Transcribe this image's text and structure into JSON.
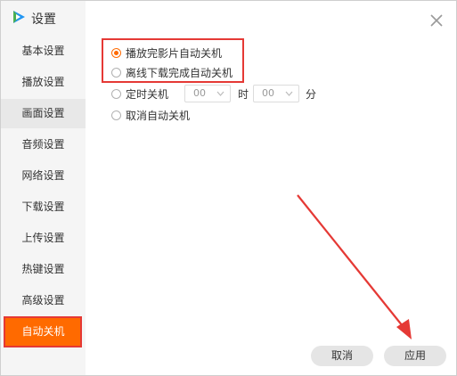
{
  "window": {
    "title": "设置",
    "close_icon": "close-icon",
    "logo_icon": "play-logo-icon"
  },
  "sidebar": {
    "items": [
      {
        "label": "基本设置"
      },
      {
        "label": "播放设置"
      },
      {
        "label": "画面设置"
      },
      {
        "label": "音频设置"
      },
      {
        "label": "网络设置"
      },
      {
        "label": "下载设置"
      },
      {
        "label": "上传设置"
      },
      {
        "label": "热键设置"
      },
      {
        "label": "高级设置"
      },
      {
        "label": "自动关机"
      }
    ],
    "active_index": 9,
    "hover_index": 2
  },
  "options": {
    "after_play": {
      "label": "播放完影片自动关机",
      "checked": true
    },
    "after_download": {
      "label": "离线下载完成自动关机",
      "checked": false
    },
    "timed": {
      "label": "定时关机",
      "checked": false,
      "hour_value": "00",
      "hour_unit": "时",
      "minute_value": "00",
      "minute_unit": "分"
    },
    "cancel": {
      "label": "取消自动关机",
      "checked": false
    }
  },
  "buttons": {
    "cancel_label": "取消",
    "apply_label": "应用"
  },
  "colors": {
    "accent": "#ff6a00",
    "annotation_red": "#e53935",
    "sidebar_bg": "#f5f5f5"
  }
}
